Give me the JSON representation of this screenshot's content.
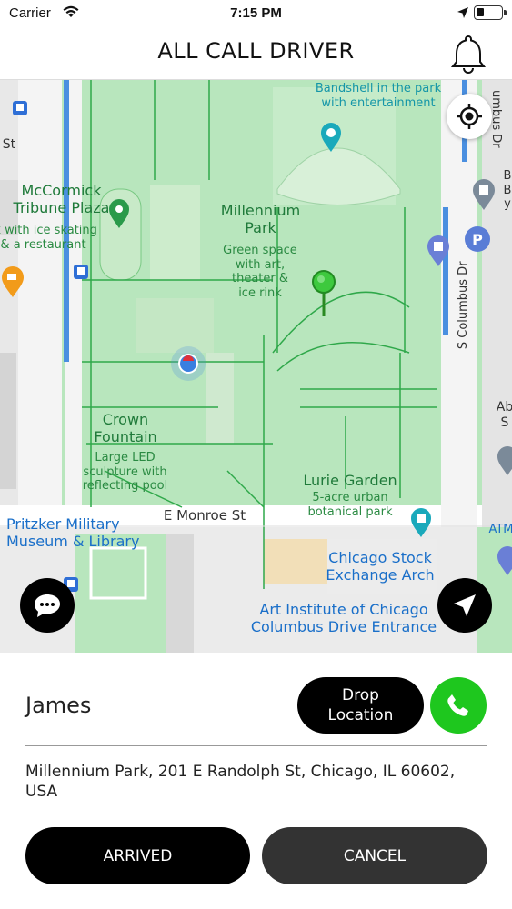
{
  "status_bar": {
    "carrier": "Carrier",
    "time": "7:15 PM"
  },
  "header": {
    "title": "ALL CALL DRIVER"
  },
  "map": {
    "labels": {
      "bandshell": "Bandshell in the park\nwith entertainment",
      "mccormick": "McCormick\nTribune Plaza",
      "mccormick_sub": "rk with ice skating\n& a restaurant",
      "millennium": "Millennium\nPark",
      "millennium_sub": "Green space\nwith art,\ntheater &\nice rink",
      "crown": "Crown\nFountain",
      "crown_sub": "Large LED\nsculpture with\nreflecting pool",
      "lurie": "Lurie Garden",
      "lurie_sub": "5-acre urban\nbotanical park",
      "monroe": "E Monroe St",
      "pritzker": "Pritzker Military\nMuseum & Library",
      "stock": "Chicago Stock\nExchange Arch",
      "art_institute": "Art Institute of Chicago\nColumbus Drive Entrance",
      "columbus": "S Columbus Dr",
      "st": "St",
      "bus_dr": "umbus Dr",
      "b_label": "B\nB\ny",
      "ab_label": "Ab\nS",
      "atm_label": "ATM"
    }
  },
  "ride": {
    "driver_name": "James",
    "drop_location_label": "Drop\nLocation",
    "address": "Millennium Park, 201 E Randolph St, Chicago, IL 60602, USA",
    "arrived_label": "ARRIVED",
    "cancel_label": "CANCEL"
  },
  "colors": {
    "accent_green": "#1ec71e",
    "button_dark": "#000000",
    "button_cancel": "#333333",
    "map_park": "#b8e6bd"
  },
  "icons": [
    "wifi-icon",
    "location-arrow-icon",
    "battery-icon",
    "bell-icon",
    "crosshair-icon",
    "chat-icon",
    "navigation-icon",
    "phone-icon"
  ]
}
